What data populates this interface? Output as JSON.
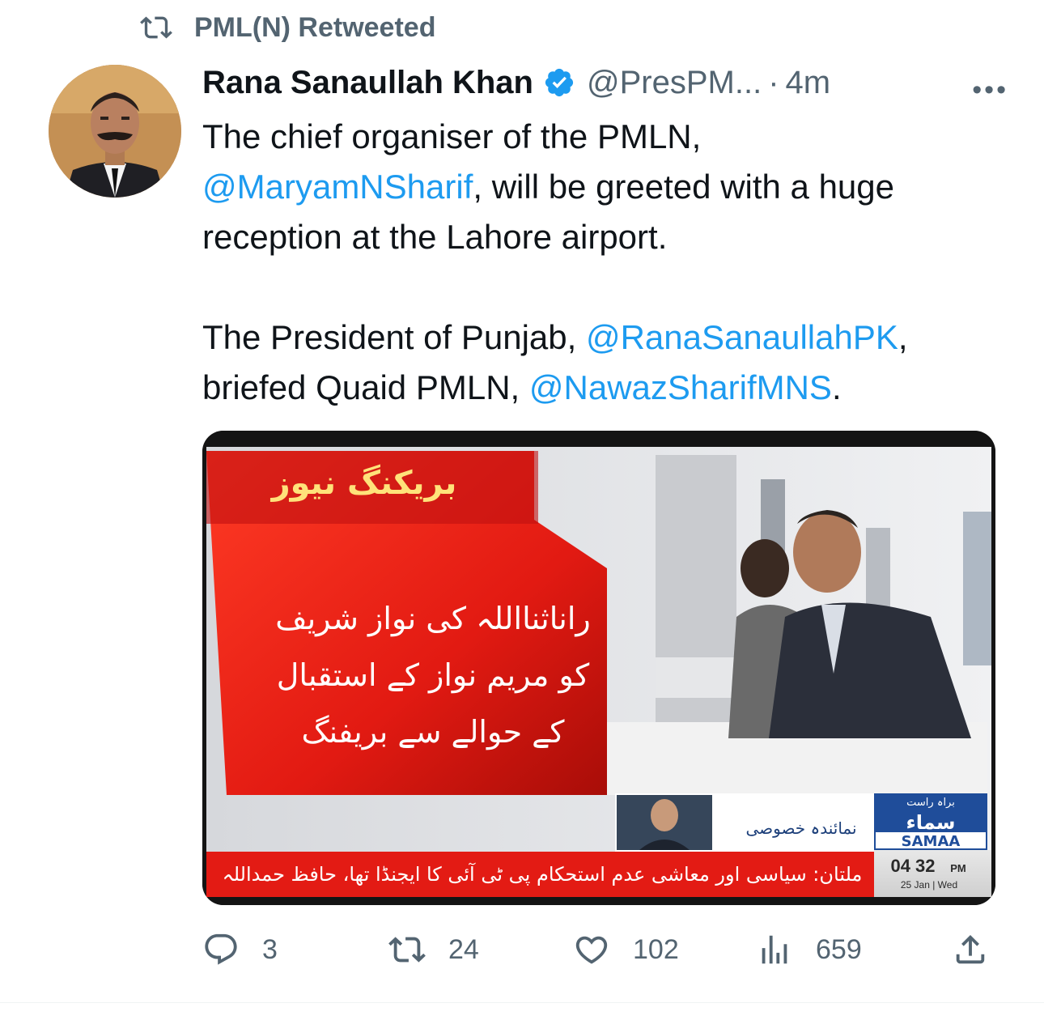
{
  "retweet_banner": {
    "label": "PML(N) Retweeted",
    "icon": "retweet-icon"
  },
  "tweet": {
    "author_name": "Rana Sanaullah Khan",
    "verified_icon": "verified-badge-icon",
    "handle": "@PresPM...",
    "separator": "·",
    "time": "4m",
    "more_icon": "more-options-icon",
    "more_label": "•••",
    "text": {
      "p1_a": "The chief organiser of the PMLN,",
      "p1_mention": "@MaryamNSharif",
      "p1_b": ", will be greeted with a huge reception at the Lahore airport.",
      "p2_a": "The President of Punjab, ",
      "p2_mention1": "@RanaSanaullahPK",
      "p2_b": ", briefed Quaid PMLN, ",
      "p2_mention2": "@NawazSharifMNS",
      "p2_c": "."
    },
    "media": {
      "breaking_label": "بریکنگ نیوز",
      "headline_line1": "راناثنااللہ کی نواز شریف",
      "headline_line2": "کو مریم نواز کے استقبال",
      "headline_line3": "کے حوالے سے بریفنگ",
      "reporter_label": "نمائندہ خصوصی",
      "live_label": "براہ راست",
      "channel_urdu": "سماء",
      "channel_name": "SAMAA",
      "clock_time": "04 32",
      "clock_ampm": "PM",
      "clock_date": "25 Jan | Wed",
      "ticker": "ملتان: سیاسی اور معاشی عدم استحکام پی ٹی آئی کا ایجنڈا تھا، حافظ حمداللہ"
    },
    "actions": {
      "reply_count": "3",
      "retweet_count": "24",
      "like_count": "102",
      "views_count": "659"
    }
  },
  "colors": {
    "link": "#1d9bf0",
    "secondary_text": "#536471",
    "primary_text": "#0f1419",
    "samaa_red": "#d9261c"
  }
}
